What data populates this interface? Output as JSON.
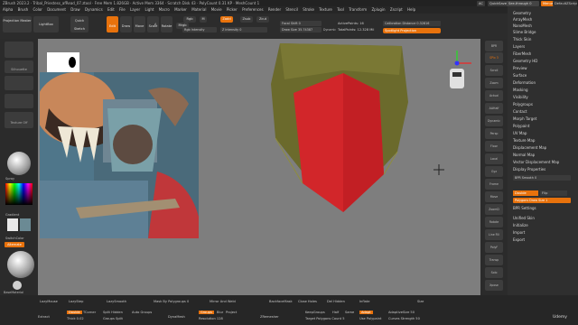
{
  "titlebar": {
    "text": "ZBrush 2023.2  ·  Tribal_Priestess_afRead_07.ztool  ·  Free Mem 1.826GB  ·  Active Mem 3364  ·  Scratch Disk 43  ·  PolyCount 0.31 KP  ·  MeshCount 1"
  },
  "topright": {
    "ac": "AC",
    "quicksave": "QuickSave",
    "seethrough": "See-through 0",
    "menus": "Menus",
    "default_script": "DefaultZScript"
  },
  "menubar": {
    "items": [
      "Alpha",
      "Brush",
      "Color",
      "Document",
      "Draw",
      "Dynamics",
      "Edit",
      "File",
      "Layer",
      "Light",
      "Macro",
      "Marker",
      "Material",
      "Movie",
      "Picker",
      "Preferences",
      "Render",
      "Stencil",
      "Stroke",
      "Texture",
      "Tool",
      "Transform",
      "Zplugin",
      "Zscript",
      "Help"
    ]
  },
  "toolbar": {
    "projection_master": "Projection Master",
    "lightbox": "LightBox",
    "quick_sketch": "Quick Sketch",
    "edit": "Edit",
    "draw": "Draw",
    "move": "Move",
    "scale": "Scale",
    "rotate": "Rotate",
    "a_label": "A",
    "mrgb": "Mrgb",
    "rgb": "Rgb",
    "m": "M",
    "zadd": "Zadd",
    "zsub": "Zsub",
    "zcut": "Zcut",
    "rgb_intensity": "Rgb Intensity",
    "z_intensity": "Z Intensity 0",
    "focal_shift": "Focal Shift 0",
    "draw_size": "Draw Size 35.74387",
    "dynamic": "Dynamic",
    "active_points": "ActivePoints: 16",
    "total_points": "TotalPoints: 12.328 Mil",
    "calibration": "Calibration Distance 0.32816",
    "spotlight": "Spotlight Projection"
  },
  "left_shelf": {
    "silhouette": "Silhouette",
    "texture_off": "Texture Off",
    "spray": "Spray",
    "gradient": "Gradient",
    "switch_color": "SwitchColor",
    "alternate": "Alternate",
    "base_material": "BaseMaterial"
  },
  "right_shelf": {
    "buttons": [
      "BPR",
      "SPix 3",
      "Scroll",
      "Zoom",
      "Actual",
      "AAHalf",
      "Dynamic",
      "Persp",
      "Floor",
      "Local",
      "Gyz",
      "Frame",
      "Move",
      "ZoomD",
      "Rotate",
      "Line Fill",
      "PolyF",
      "Transp",
      "Solo",
      "Xpose"
    ]
  },
  "tray": {
    "items": [
      "Geometry",
      "ArrayMesh",
      "NanoMesh",
      "Slime Bridge",
      "Thick Skin",
      "Layers",
      "FiberMesh",
      "Geometry HD",
      "Preview",
      "Surface",
      "Deformation",
      "Masking",
      "Visibility",
      "Polygroups",
      "Contact",
      "Morph Target",
      "Polypaint",
      "UV Map",
      "Texture Map",
      "Displacement Map",
      "Normal Map",
      "Vector Displacement Map",
      "Display Properties"
    ],
    "bpr_smooth": "BPR Smooth 0",
    "double": "Double",
    "flip": "Flip",
    "polygon_draw_size": "Polygons Draw Size 1",
    "bpr_settings": "BPR Settings",
    "lower_items": [
      "Unified Skin",
      "Initialize",
      "Import",
      "Export"
    ]
  },
  "bottom": {
    "lazy_mouse": "LazyMouse",
    "lazy_step": "LazyStep",
    "lazy_smooth": "LazySmooth",
    "mask_polygroups": "Mask By Polygroups 0",
    "mirror_weld": "Mirror And Weld",
    "backface_mask": "BackfaceMask",
    "close_holes": "Close Holes",
    "del_hidden": "Del Hidden",
    "inflate": "Inflate",
    "size": "Size",
    "extract": "Extract",
    "double": "Double",
    "tcorner": "TCorner",
    "thick": "Thick 0.02",
    "split_hidden": "Split Hidden",
    "groups_split": "Groups Split",
    "auto_groups": "Auto Groups",
    "dynamesh": "DynaMesh",
    "groups": "Groups",
    "blur": "Blur",
    "project": "Project",
    "resolution": "Resolution 128",
    "zremesher": "ZRemesher",
    "keep_groups": "KeepGroups",
    "half": "Half",
    "same": "Same",
    "adapt": "Adapt",
    "adaptive_size": "AdaptiveSize 50",
    "target_polygons": "Target Polygons Count 5",
    "use_polypaint": "Use Polypaint",
    "curves_strength": "Curves Strength 50",
    "udemy": "Udemy"
  },
  "colors": {
    "accent": "#e8720c",
    "canvas": "#7e7e7e",
    "mesh_olive": "#6b6a2c",
    "mesh_red": "#d2262a"
  }
}
